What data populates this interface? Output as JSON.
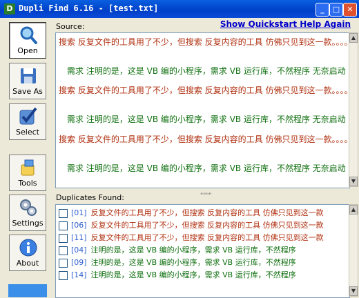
{
  "window": {
    "title": "Dupli Find 6.16 - [test.txt]",
    "app_icon": "D",
    "minimize": "_",
    "maximize": "□",
    "close": "✕"
  },
  "toolbar": [
    {
      "label": "Open",
      "icon": "magnifier-icon"
    },
    {
      "label": "Save As",
      "icon": "floppy-icon"
    },
    {
      "label": "Select",
      "icon": "checkmark-icon"
    },
    {
      "label": "Tools",
      "icon": "tools-icon"
    },
    {
      "label": "Settings",
      "icon": "gears-icon"
    },
    {
      "label": "About",
      "icon": "info-icon"
    }
  ],
  "source": {
    "label": "Source:",
    "help_link": "Show Quickstart Help Again",
    "lines": [
      {
        "text": "搜索 反复文件的工具用了不少，但搜索 反复内容的工具 仿佛只见到这一款。。。。",
        "color": "red"
      },
      {
        "text": "需求 注明的是，这是 VB 编的小程序，需求 VB 运行库，不然程序 无奈启动",
        "color": "green"
      },
      {
        "text": "搜索 反复文件的工具用了不少，但搜索 反复内容的工具 仿佛只见到这一款。。。。",
        "color": "red"
      },
      {
        "text": "需求 注明的是，这是 VB 编的小程序，需求 VB 运行库，不然程序 无奈启动",
        "color": "green"
      },
      {
        "text": "搜索 反复文件的工具用了不少，但搜索 反复内容的工具 仿佛只见到这一款。。。。",
        "color": "red"
      },
      {
        "text": "需求 注明的是，这是 VB 编的小程序，需求 VB 运行库，不然程序 无奈启动",
        "color": "green"
      }
    ]
  },
  "duplicates": {
    "label": "Duplicates Found:",
    "splitter": "\"\"\"\"",
    "rows": [
      {
        "index": "[01]",
        "text": "反复文件的工具用了不少，但搜索 反复内容的工具 仿佛只见到这一款",
        "color": "red"
      },
      {
        "index": "[06]",
        "text": "反复文件的工具用了不少，但搜索 反复内容的工具 仿佛只见到这一款",
        "color": "red"
      },
      {
        "index": "[11]",
        "text": "反复文件的工具用了不少，但搜索 反复内容的工具 仿佛只见到这一款",
        "color": "red"
      },
      {
        "index": "[04]",
        "text": "注明的是，这是 VB 编的小程序，需求 VB 运行库，不然程序",
        "color": "green"
      },
      {
        "index": "[09]",
        "text": "注明的是，这是 VB 编的小程序，需求 VB 运行库，不然程序",
        "color": "green"
      },
      {
        "index": "[14]",
        "text": "注明的是，这是 VB 编的小程序，需求 VB 运行库，不然程序",
        "color": "green"
      }
    ]
  },
  "colors": {
    "red_text": "#b03010",
    "green_text": "#107010",
    "link": "#0000cc",
    "titlebar": "#0a4ad8"
  }
}
